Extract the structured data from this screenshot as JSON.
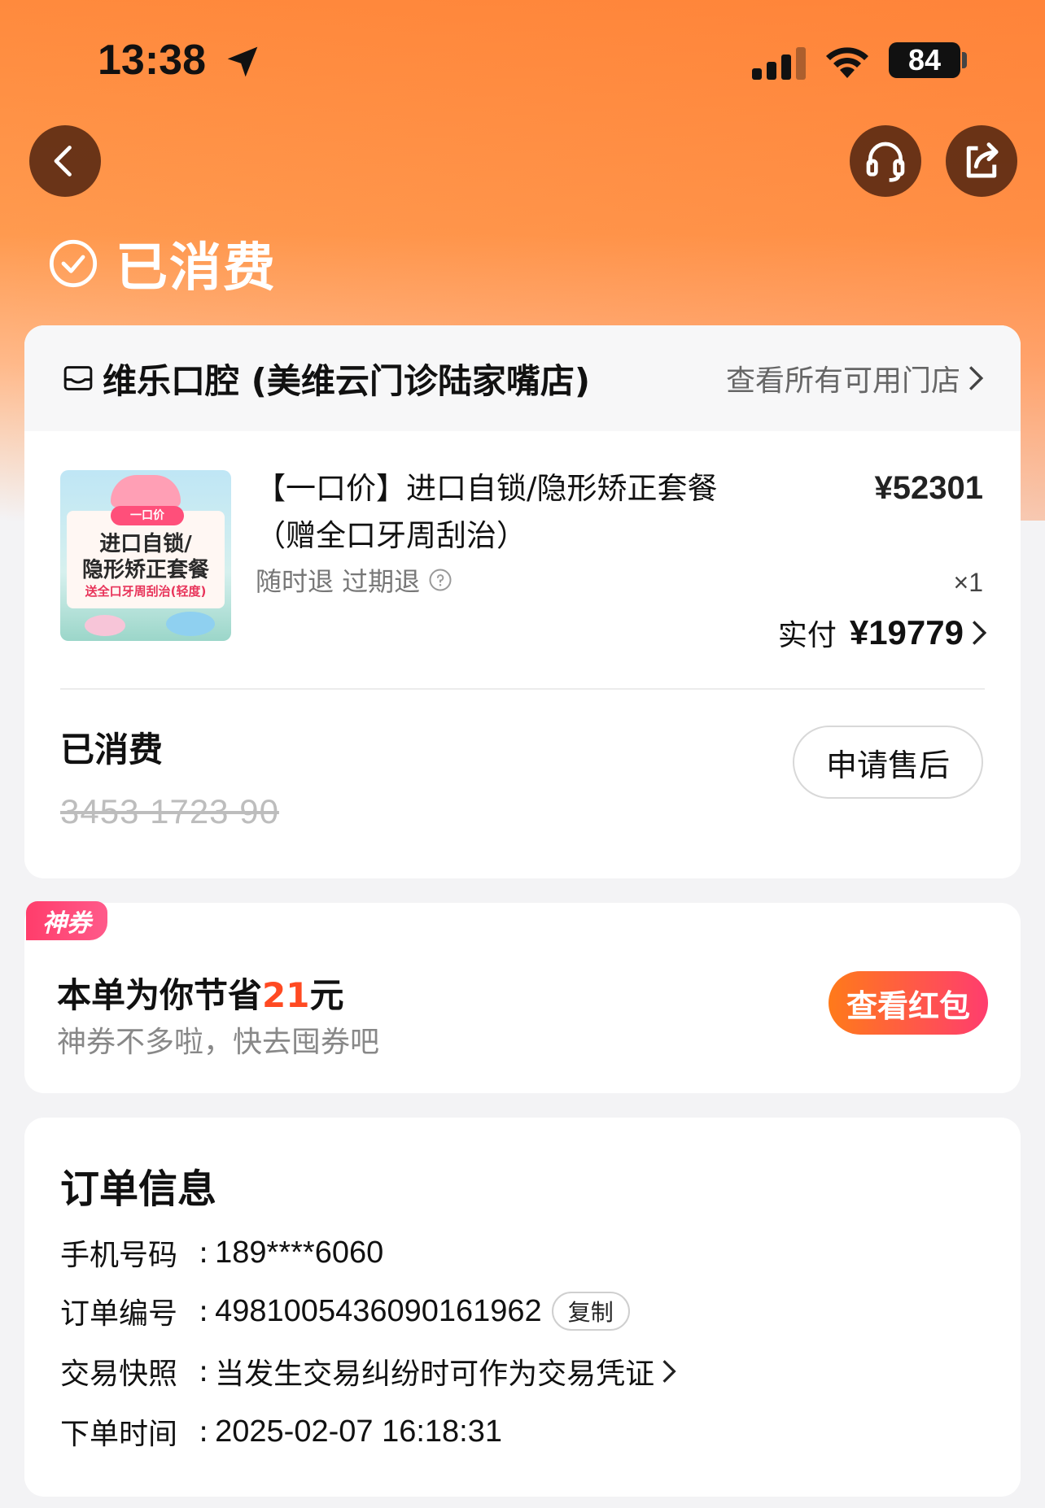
{
  "status_bar": {
    "time": "13:38",
    "battery": "84"
  },
  "header": {
    "status": "已消费"
  },
  "store": {
    "name": "维乐口腔 (美维云门诊陆家嘴店)",
    "link": "查看所有可用门店"
  },
  "product": {
    "image_tag": "一口价",
    "image_line1": "进口自锁/",
    "image_line2": "隐形矫正套餐",
    "image_line3": "送全口牙周刮治(轻度)",
    "title": "【一口价】进口自锁/隐形矫正套餐（赠全口牙周刮治）",
    "price": "¥52301",
    "tags": "随时退 过期退",
    "qty": "×1",
    "paid_label": "实付",
    "paid_amount": "¥19779"
  },
  "voucher": {
    "status": "已消费",
    "code": "3453 1723 90",
    "aftersale_label": "申请售后"
  },
  "coupon": {
    "badge": "神券",
    "line1_prefix": "本单为你节省",
    "line1_amount": "21",
    "line1_suffix": "元",
    "line2": "神券不多啦，快去囤券吧",
    "button": "查看红包"
  },
  "order_info": {
    "title": "订单信息",
    "phone_label": "手机号码",
    "phone": "189****6060",
    "order_no_label": "订单编号",
    "order_no": "4981005436090161962",
    "copy_label": "复制",
    "snapshot_label": "交易快照",
    "snapshot_text": "当发生交易纠纷时可作为交易凭证",
    "time_label": "下单时间",
    "time": "2025-02-07 16:18:31",
    "separator": ":"
  },
  "colors": {
    "accent": "#ff8a3d",
    "highlight": "#ff4a22",
    "badge": "#ff3d6b"
  },
  "icons": [
    "location-arrow-icon",
    "signal-icon",
    "wifi-icon",
    "back-icon",
    "headset-icon",
    "share-icon",
    "check-circle-icon",
    "store-icon",
    "chevron-right-icon",
    "question-icon"
  ]
}
